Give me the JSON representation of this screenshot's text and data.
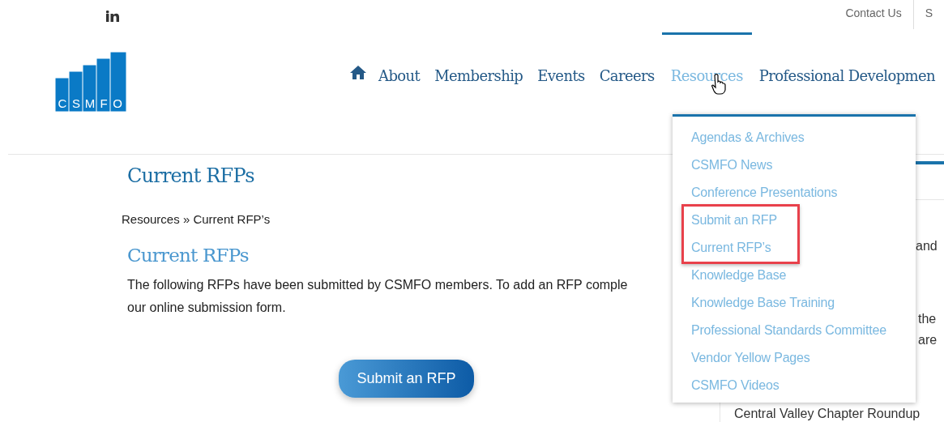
{
  "top_bar": {
    "links": [
      "Contact Us",
      "S"
    ]
  },
  "logo": {
    "letters": [
      "C",
      "S",
      "M",
      "F",
      "O"
    ]
  },
  "nav": [
    {
      "label": "About",
      "selected": false
    },
    {
      "label": "Membership",
      "selected": false
    },
    {
      "label": "Events",
      "selected": false
    },
    {
      "label": "Careers",
      "selected": false
    },
    {
      "label": "Resources",
      "selected": true
    },
    {
      "label": "Professional Developmen",
      "selected": false
    }
  ],
  "dropdown": [
    {
      "label": "Agendas & Archives",
      "highlighted": false
    },
    {
      "label": "CSMFO News",
      "highlighted": false
    },
    {
      "label": "Conference Presentations",
      "highlighted": false
    },
    {
      "label": "Submit an RFP",
      "highlighted": true
    },
    {
      "label": "Current RFP’s",
      "highlighted": true
    },
    {
      "label": "Knowledge Base",
      "highlighted": false
    },
    {
      "label": "Knowledge Base Training",
      "highlighted": false
    },
    {
      "label": "Professional Standards Committee",
      "highlighted": false
    },
    {
      "label": "Vendor Yellow Pages",
      "highlighted": false
    },
    {
      "label": "CSMFO Videos",
      "highlighted": false
    }
  ],
  "page_title": "Current RFPs",
  "breadcrumb": {
    "parent": "Resources",
    "separator": "»",
    "current": "Current RFP’s"
  },
  "heading": "Current RFPs",
  "intro_lines": [
    "The following RFPs have been submitted by CSMFO members. To add an RFP comple",
    "our online submission form."
  ],
  "submit_button": "Submit an RFP",
  "sidebar": {
    "fragments": [
      "and",
      "the",
      "are"
    ],
    "link": "Central Valley Chapter Roundup"
  }
}
